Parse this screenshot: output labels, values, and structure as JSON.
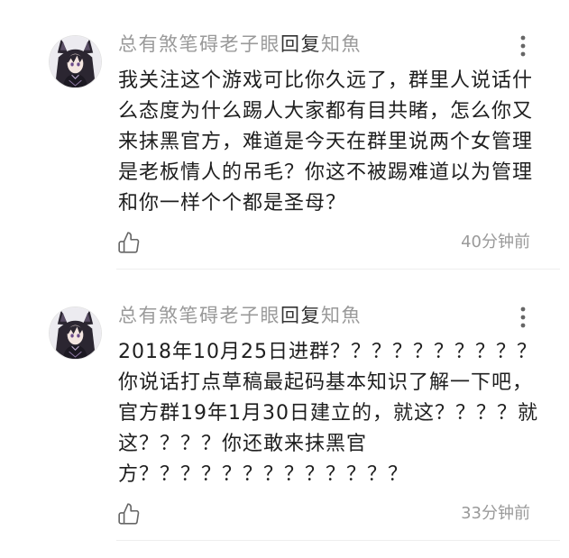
{
  "colors": {
    "background": "#ffffff",
    "username": "#9a9a9a",
    "reply_label": "#333333",
    "comment_text": "#1f1f1f",
    "timestamp": "#9a9a9a",
    "icon": "#666666",
    "divider": "#eeeeee"
  },
  "icons": {
    "avatar": "anime-girl-avatar",
    "more": "more-vertical-icon",
    "like": "thumbs-up-icon"
  },
  "comments": [
    {
      "author": "总有煞笔碍老子眼",
      "reply_label": "回复",
      "reply_to": "知魚",
      "text_lines": [
        "我关注这个游戏可比你久远了，群里人说话什",
        "么态度为什么踢人大家都有目共睹，怎么你又",
        "来抹黑官方，难道是今天在群里说两个女管理",
        "是老板情人的吊毛？你这不被踢难道以为管理",
        "和你一样个个都是圣母？"
      ],
      "time": "40分钟前"
    },
    {
      "author": "总有煞笔碍老子眼",
      "reply_label": "回复",
      "reply_to": "知魚",
      "text_lines": [
        "2018年10月25日进群？？？？？？？？？？",
        "你说话打点草稿最起码基本知识了解一下吧，",
        "官方群19年1月30日建立的，就这？？？？就",
        "这？？？？你还敢来抹黑官",
        "方？？？？？？？？？？？？？"
      ],
      "time": "33分钟前"
    }
  ]
}
